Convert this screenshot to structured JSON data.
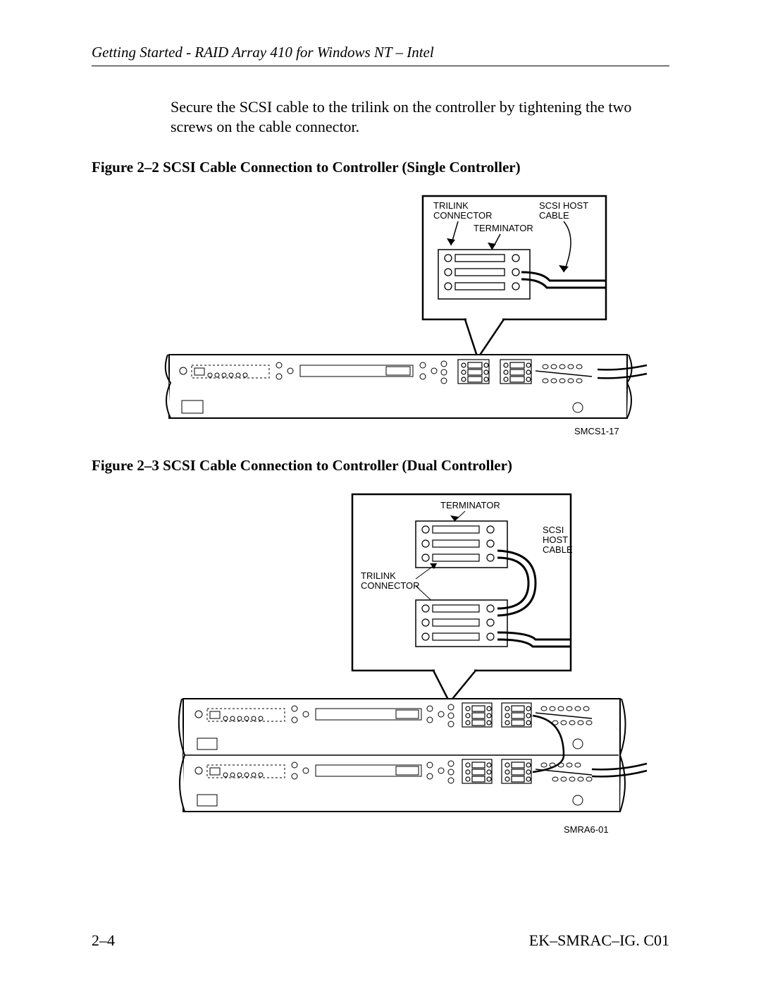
{
  "header": "Getting Started - RAID Array 410 for Windows NT – Intel",
  "body_text": "Secure the SCSI cable to the trilink on the controller by tightening the two screws on the cable connector.",
  "figure1": {
    "caption": "Figure 2–2  SCSI Cable Connection to Controller (Single Controller)",
    "labels": {
      "trilink": "TRILINK CONNECTOR",
      "terminator": "TERMINATOR",
      "scsi_host": "SCSI HOST CABLE",
      "ref": "SMCS1-17"
    }
  },
  "figure2": {
    "caption": "Figure 2–3  SCSI Cable  Connection to Controller (Dual Controller)",
    "labels": {
      "terminator": "TERMINATOR",
      "trilink": "TRILINK CONNECTOR",
      "scsi_host": "SCSI HOST CABLE",
      "ref": "SMRA6-01"
    }
  },
  "footer": {
    "left": "2–4",
    "right": "EK–SMRAC–IG. C01"
  }
}
